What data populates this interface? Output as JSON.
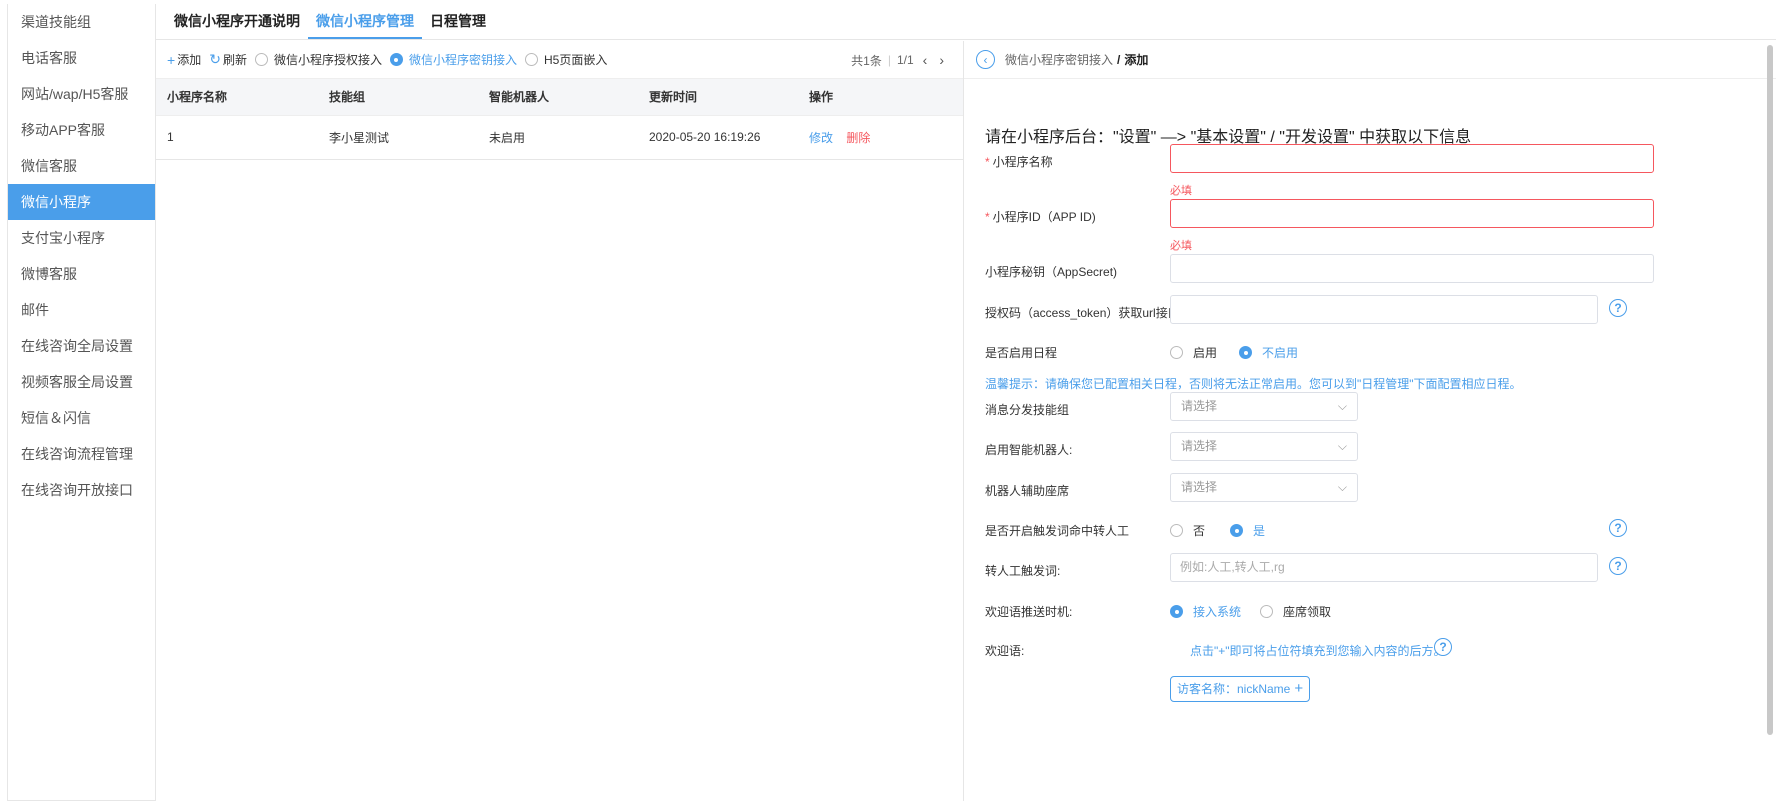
{
  "sidebar": {
    "items": [
      {
        "label": "渠道技能组"
      },
      {
        "label": "电话客服"
      },
      {
        "label": "网站/wap/H5客服"
      },
      {
        "label": "移动APP客服"
      },
      {
        "label": "微信客服"
      },
      {
        "label": "微信小程序",
        "active": true
      },
      {
        "label": "支付宝小程序"
      },
      {
        "label": "微博客服"
      },
      {
        "label": "邮件"
      },
      {
        "label": "在线咨询全局设置"
      },
      {
        "label": "视频客服全局设置"
      },
      {
        "label": "短信＆闪信"
      },
      {
        "label": "在线咨询流程管理"
      },
      {
        "label": "在线咨询开放接口"
      }
    ]
  },
  "tabs": {
    "t1": "微信小程序开通说明",
    "t2": "微信小程序管理",
    "t3": "日程管理"
  },
  "toolbar": {
    "add": "添加",
    "refresh": "刷新",
    "radio1": "微信小程序授权接入",
    "radio2": "微信小程序密钥接入",
    "radio3": "H5页面嵌入",
    "total": "共1条",
    "page": "1/1"
  },
  "table": {
    "headers": [
      "小程序名称",
      "技能组",
      "智能机器人",
      "更新时间",
      "操作"
    ],
    "rows": [
      {
        "name": "1",
        "group": "李小星测试",
        "robot": "未启用",
        "updated": "2020-05-20 16:19:26",
        "edit": "修改",
        "delete": "删除"
      }
    ]
  },
  "panel": {
    "crumb_parent": "微信小程序密钥接入",
    "crumb_sep": "/",
    "crumb_current": "添加",
    "title": "请在小程序后台：\"设置\" —> \"基本设置\" / \"开发设置\" 中获取以下信息",
    "required_mark": "*",
    "required_error": "必填",
    "fields": {
      "name": "小程序名称",
      "appid": "小程序ID（APP ID)",
      "secret": "小程序秘钥（AppSecret)",
      "token_url": "授权码（access_token）获取url接口",
      "schedule": "是否启用日程",
      "schedule_on": "启用",
      "schedule_off": "不启用",
      "tip": "温馨提示：请确保您已配置相关日程，否则将无法正常启用。您可以到\"日程管理\"下面配置相应日程。",
      "group": "消息分发技能组",
      "robot": "启用智能机器人:",
      "assist": "机器人辅助座席",
      "select_placeholder": "请选择",
      "trigger": "是否开启触发词命中转人工",
      "trigger_no": "否",
      "trigger_yes": "是",
      "trigger_words": "转人工触发词:",
      "trigger_placeholder": "例如:人工,转人工,rg",
      "welcome_timing": "欢迎语推送时机:",
      "timing_system": "接入系统",
      "timing_agent": "座席领取",
      "welcome": "欢迎语:",
      "welcome_note": "点击\"+\"即可将占位符填充到您输入内容的后方。",
      "visitor_tag": "访客名称：nickName"
    }
  }
}
